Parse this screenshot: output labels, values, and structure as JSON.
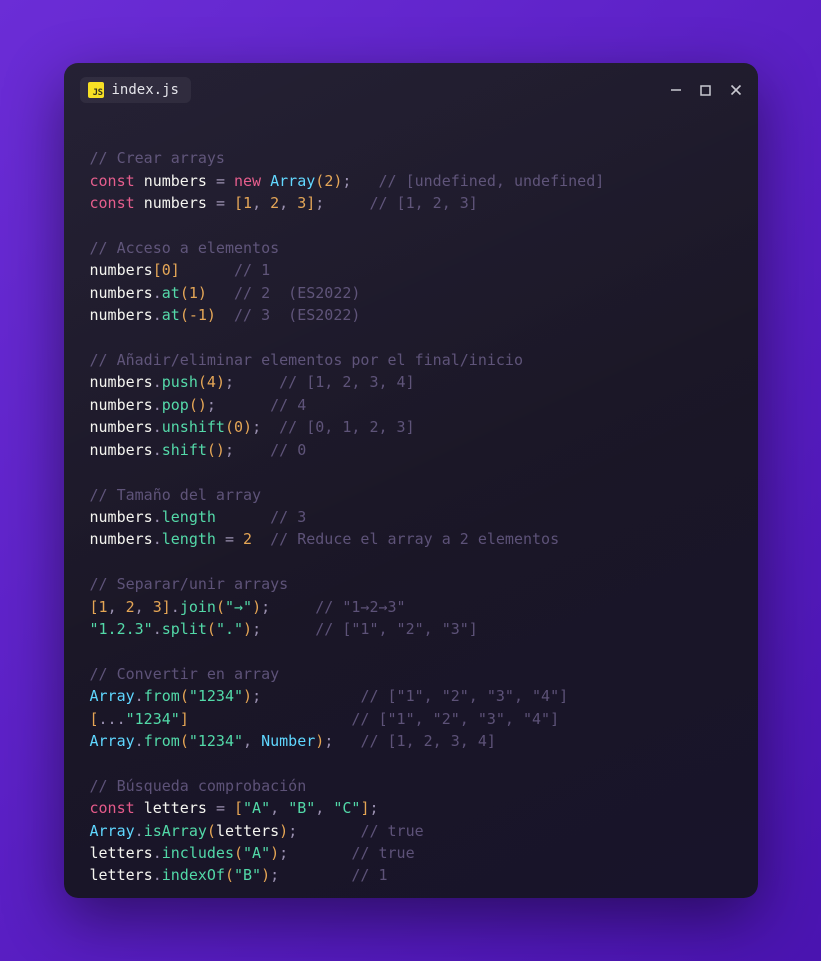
{
  "tab": {
    "icon_label": "JS",
    "filename": "index.js"
  },
  "code": {
    "c1": "// Crear arrays",
    "l2_kw": "const",
    "l2_var": "numbers",
    "l2_cls": "Array",
    "l2_num": "2",
    "l2_cmt": "// [undefined, undefined]",
    "l3_kw": "const",
    "l3_var": "numbers",
    "l3_n1": "1",
    "l3_n2": "2",
    "l3_n3": "3",
    "l3_cmt": "// [1, 2, 3]",
    "c2": "// Acceso a elementos",
    "l5_var": "numbers",
    "l5_idx": "0",
    "l5_cmt": "// 1",
    "l6_var": "numbers",
    "l6_fn": "at",
    "l6_arg": "1",
    "l6_cmt": "// 2  (ES2022)",
    "l7_var": "numbers",
    "l7_fn": "at",
    "l7_arg": "-1",
    "l7_cmt": "// 3  (ES2022)",
    "c3": "// Añadir/eliminar elementos por el final/inicio",
    "l8_var": "numbers",
    "l8_fn": "push",
    "l8_arg": "4",
    "l8_cmt": "// [1, 2, 3, 4]",
    "l9_var": "numbers",
    "l9_fn": "pop",
    "l9_cmt": "// 4",
    "l10_var": "numbers",
    "l10_fn": "unshift",
    "l10_arg": "0",
    "l10_cmt": "// [0, 1, 2, 3]",
    "l11_var": "numbers",
    "l11_fn": "shift",
    "l11_cmt": "// 0",
    "c4": "// Tamaño del array",
    "l12_var": "numbers",
    "l12_prop": "length",
    "l12_cmt": "// 3",
    "l13_var": "numbers",
    "l13_prop": "length",
    "l13_val": "2",
    "l13_cmt": "// Reduce el array a 2 elementos",
    "c5": "// Separar/unir arrays",
    "l14_n1": "1",
    "l14_n2": "2",
    "l14_n3": "3",
    "l14_fn": "join",
    "l14_arg": "\"→\"",
    "l14_cmt": "// \"1→2→3\"",
    "l15_str": "\"1.2.3\"",
    "l15_fn": "split",
    "l15_arg": "\".\"",
    "l15_cmt": "// [\"1\", \"2\", \"3\"]",
    "c6": "// Convertir en array",
    "l16_cls": "Array",
    "l16_fn": "from",
    "l16_arg": "\"1234\"",
    "l16_cmt": "// [\"1\", \"2\", \"3\", \"4\"]",
    "l17_arg": "\"1234\"",
    "l17_cmt": "// [\"1\", \"2\", \"3\", \"4\"]",
    "l18_cls": "Array",
    "l18_fn": "from",
    "l18_arg1": "\"1234\"",
    "l18_arg2": "Number",
    "l18_cmt": "// [1, 2, 3, 4]",
    "c7": "// Búsqueda comprobación",
    "l19_kw": "const",
    "l19_var": "letters",
    "l19_s1": "\"A\"",
    "l19_s2": "\"B\"",
    "l19_s3": "\"C\"",
    "l20_cls": "Array",
    "l20_fn": "isArray",
    "l20_arg": "letters",
    "l20_cmt": "// true",
    "l21_var": "letters",
    "l21_fn": "includes",
    "l21_arg": "\"A\"",
    "l21_cmt": "// true",
    "l22_var": "letters",
    "l22_fn": "indexOf",
    "l22_arg": "\"B\"",
    "l22_cmt": "// 1"
  }
}
